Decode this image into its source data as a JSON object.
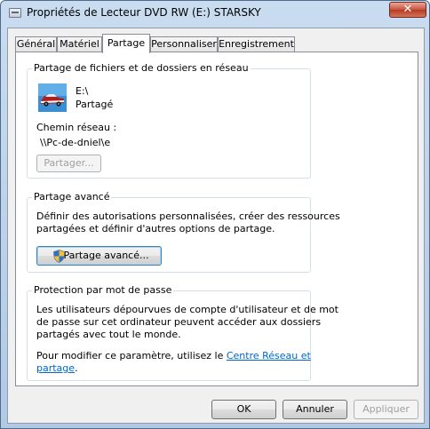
{
  "window": {
    "title": "Propriétés de Lecteur DVD RW (E:) STARSKY",
    "close_label": "✕"
  },
  "tabs": [
    {
      "label": "Général"
    },
    {
      "label": "Matériel"
    },
    {
      "label": "Partage"
    },
    {
      "label": "Personnaliser"
    },
    {
      "label": "Enregistrement"
    }
  ],
  "sharing": {
    "legend": "Partage de fichiers et de dossiers en réseau",
    "drive_name": "E:\\",
    "status": "Partagé",
    "network_path_label": "Chemin réseau :",
    "network_path": "\\\\Pc-de-dniel\\e",
    "share_button": "Partager..."
  },
  "advanced": {
    "legend": "Partage avancé",
    "desc_line1": "Définir des autorisations personnalisées, créer des ressources",
    "desc_line2": "partagées et définir d'autres options de partage.",
    "button": "Partage avancé..."
  },
  "password": {
    "legend": "Protection par mot de passe",
    "desc_line1": "Les utilisateurs dépourvues de compte d'utilisateur et de mot",
    "desc_line2": "de passe sur cet ordinateur peuvent accéder aux dossiers",
    "desc_line3": "partagés avec tout le monde.",
    "modify_prefix": "Pour modifier ce paramètre, utilisez le ",
    "link_part1": "Centre Réseau et",
    "link_part2": "partage",
    "modify_suffix": "."
  },
  "footer": {
    "ok": "OK",
    "cancel": "Annuler",
    "apply": "Appliquer"
  }
}
